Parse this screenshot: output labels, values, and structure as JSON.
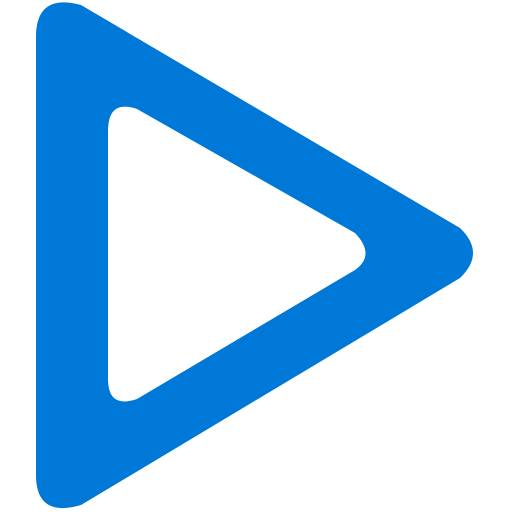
{
  "icon": {
    "name": "play-icon",
    "style": "outlined-rounded-triangle",
    "accent_color": "#0078D7",
    "background_color": "#FFFFFF"
  }
}
